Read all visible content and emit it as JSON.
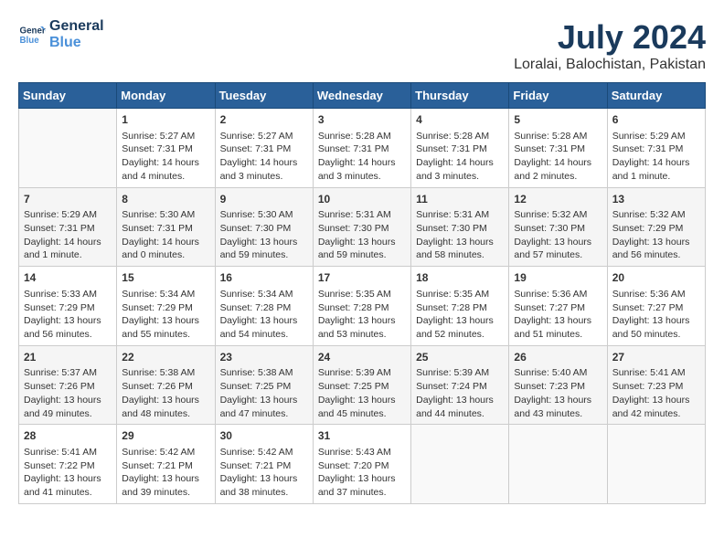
{
  "header": {
    "logo_line1": "General",
    "logo_line2": "Blue",
    "month": "July 2024",
    "location": "Loralai, Balochistan, Pakistan"
  },
  "days_of_week": [
    "Sunday",
    "Monday",
    "Tuesday",
    "Wednesday",
    "Thursday",
    "Friday",
    "Saturday"
  ],
  "weeks": [
    [
      {
        "day": "",
        "info": ""
      },
      {
        "day": "1",
        "info": "Sunrise: 5:27 AM\nSunset: 7:31 PM\nDaylight: 14 hours\nand 4 minutes."
      },
      {
        "day": "2",
        "info": "Sunrise: 5:27 AM\nSunset: 7:31 PM\nDaylight: 14 hours\nand 3 minutes."
      },
      {
        "day": "3",
        "info": "Sunrise: 5:28 AM\nSunset: 7:31 PM\nDaylight: 14 hours\nand 3 minutes."
      },
      {
        "day": "4",
        "info": "Sunrise: 5:28 AM\nSunset: 7:31 PM\nDaylight: 14 hours\nand 3 minutes."
      },
      {
        "day": "5",
        "info": "Sunrise: 5:28 AM\nSunset: 7:31 PM\nDaylight: 14 hours\nand 2 minutes."
      },
      {
        "day": "6",
        "info": "Sunrise: 5:29 AM\nSunset: 7:31 PM\nDaylight: 14 hours\nand 1 minute."
      }
    ],
    [
      {
        "day": "7",
        "info": "Sunrise: 5:29 AM\nSunset: 7:31 PM\nDaylight: 14 hours\nand 1 minute."
      },
      {
        "day": "8",
        "info": "Sunrise: 5:30 AM\nSunset: 7:31 PM\nDaylight: 14 hours\nand 0 minutes."
      },
      {
        "day": "9",
        "info": "Sunrise: 5:30 AM\nSunset: 7:30 PM\nDaylight: 13 hours\nand 59 minutes."
      },
      {
        "day": "10",
        "info": "Sunrise: 5:31 AM\nSunset: 7:30 PM\nDaylight: 13 hours\nand 59 minutes."
      },
      {
        "day": "11",
        "info": "Sunrise: 5:31 AM\nSunset: 7:30 PM\nDaylight: 13 hours\nand 58 minutes."
      },
      {
        "day": "12",
        "info": "Sunrise: 5:32 AM\nSunset: 7:30 PM\nDaylight: 13 hours\nand 57 minutes."
      },
      {
        "day": "13",
        "info": "Sunrise: 5:32 AM\nSunset: 7:29 PM\nDaylight: 13 hours\nand 56 minutes."
      }
    ],
    [
      {
        "day": "14",
        "info": "Sunrise: 5:33 AM\nSunset: 7:29 PM\nDaylight: 13 hours\nand 56 minutes."
      },
      {
        "day": "15",
        "info": "Sunrise: 5:34 AM\nSunset: 7:29 PM\nDaylight: 13 hours\nand 55 minutes."
      },
      {
        "day": "16",
        "info": "Sunrise: 5:34 AM\nSunset: 7:28 PM\nDaylight: 13 hours\nand 54 minutes."
      },
      {
        "day": "17",
        "info": "Sunrise: 5:35 AM\nSunset: 7:28 PM\nDaylight: 13 hours\nand 53 minutes."
      },
      {
        "day": "18",
        "info": "Sunrise: 5:35 AM\nSunset: 7:28 PM\nDaylight: 13 hours\nand 52 minutes."
      },
      {
        "day": "19",
        "info": "Sunrise: 5:36 AM\nSunset: 7:27 PM\nDaylight: 13 hours\nand 51 minutes."
      },
      {
        "day": "20",
        "info": "Sunrise: 5:36 AM\nSunset: 7:27 PM\nDaylight: 13 hours\nand 50 minutes."
      }
    ],
    [
      {
        "day": "21",
        "info": "Sunrise: 5:37 AM\nSunset: 7:26 PM\nDaylight: 13 hours\nand 49 minutes."
      },
      {
        "day": "22",
        "info": "Sunrise: 5:38 AM\nSunset: 7:26 PM\nDaylight: 13 hours\nand 48 minutes."
      },
      {
        "day": "23",
        "info": "Sunrise: 5:38 AM\nSunset: 7:25 PM\nDaylight: 13 hours\nand 47 minutes."
      },
      {
        "day": "24",
        "info": "Sunrise: 5:39 AM\nSunset: 7:25 PM\nDaylight: 13 hours\nand 45 minutes."
      },
      {
        "day": "25",
        "info": "Sunrise: 5:39 AM\nSunset: 7:24 PM\nDaylight: 13 hours\nand 44 minutes."
      },
      {
        "day": "26",
        "info": "Sunrise: 5:40 AM\nSunset: 7:23 PM\nDaylight: 13 hours\nand 43 minutes."
      },
      {
        "day": "27",
        "info": "Sunrise: 5:41 AM\nSunset: 7:23 PM\nDaylight: 13 hours\nand 42 minutes."
      }
    ],
    [
      {
        "day": "28",
        "info": "Sunrise: 5:41 AM\nSunset: 7:22 PM\nDaylight: 13 hours\nand 41 minutes."
      },
      {
        "day": "29",
        "info": "Sunrise: 5:42 AM\nSunset: 7:21 PM\nDaylight: 13 hours\nand 39 minutes."
      },
      {
        "day": "30",
        "info": "Sunrise: 5:42 AM\nSunset: 7:21 PM\nDaylight: 13 hours\nand 38 minutes."
      },
      {
        "day": "31",
        "info": "Sunrise: 5:43 AM\nSunset: 7:20 PM\nDaylight: 13 hours\nand 37 minutes."
      },
      {
        "day": "",
        "info": ""
      },
      {
        "day": "",
        "info": ""
      },
      {
        "day": "",
        "info": ""
      }
    ]
  ]
}
